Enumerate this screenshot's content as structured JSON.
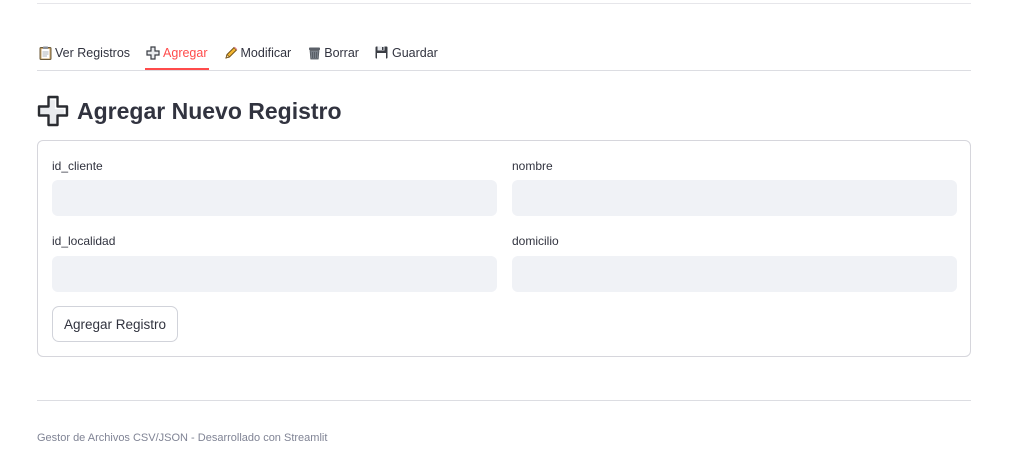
{
  "tabs": [
    {
      "label": "Ver Registros",
      "icon": "clipboard-icon",
      "active": false
    },
    {
      "label": "Agregar",
      "icon": "plus-icon",
      "active": true
    },
    {
      "label": "Modificar",
      "icon": "pencil-icon",
      "active": false
    },
    {
      "label": "Borrar",
      "icon": "trash-icon",
      "active": false
    },
    {
      "label": "Guardar",
      "icon": "floppy-disk-icon",
      "active": false
    }
  ],
  "heading": {
    "icon": "plus-icon",
    "title": "Agregar Nuevo Registro"
  },
  "form": {
    "fields": [
      {
        "label": "id_cliente",
        "value": ""
      },
      {
        "label": "nombre",
        "value": ""
      },
      {
        "label": "id_localidad",
        "value": ""
      },
      {
        "label": "domicilio",
        "value": ""
      }
    ],
    "submit_label": "Agregar Registro"
  },
  "footer": {
    "text": "Gestor de Archivos CSV/JSON - Desarrollado con Streamlit"
  },
  "colors": {
    "accent": "#ff4b4b",
    "input_bg": "#f0f2f6",
    "text": "#31333f",
    "muted": "#808495"
  }
}
